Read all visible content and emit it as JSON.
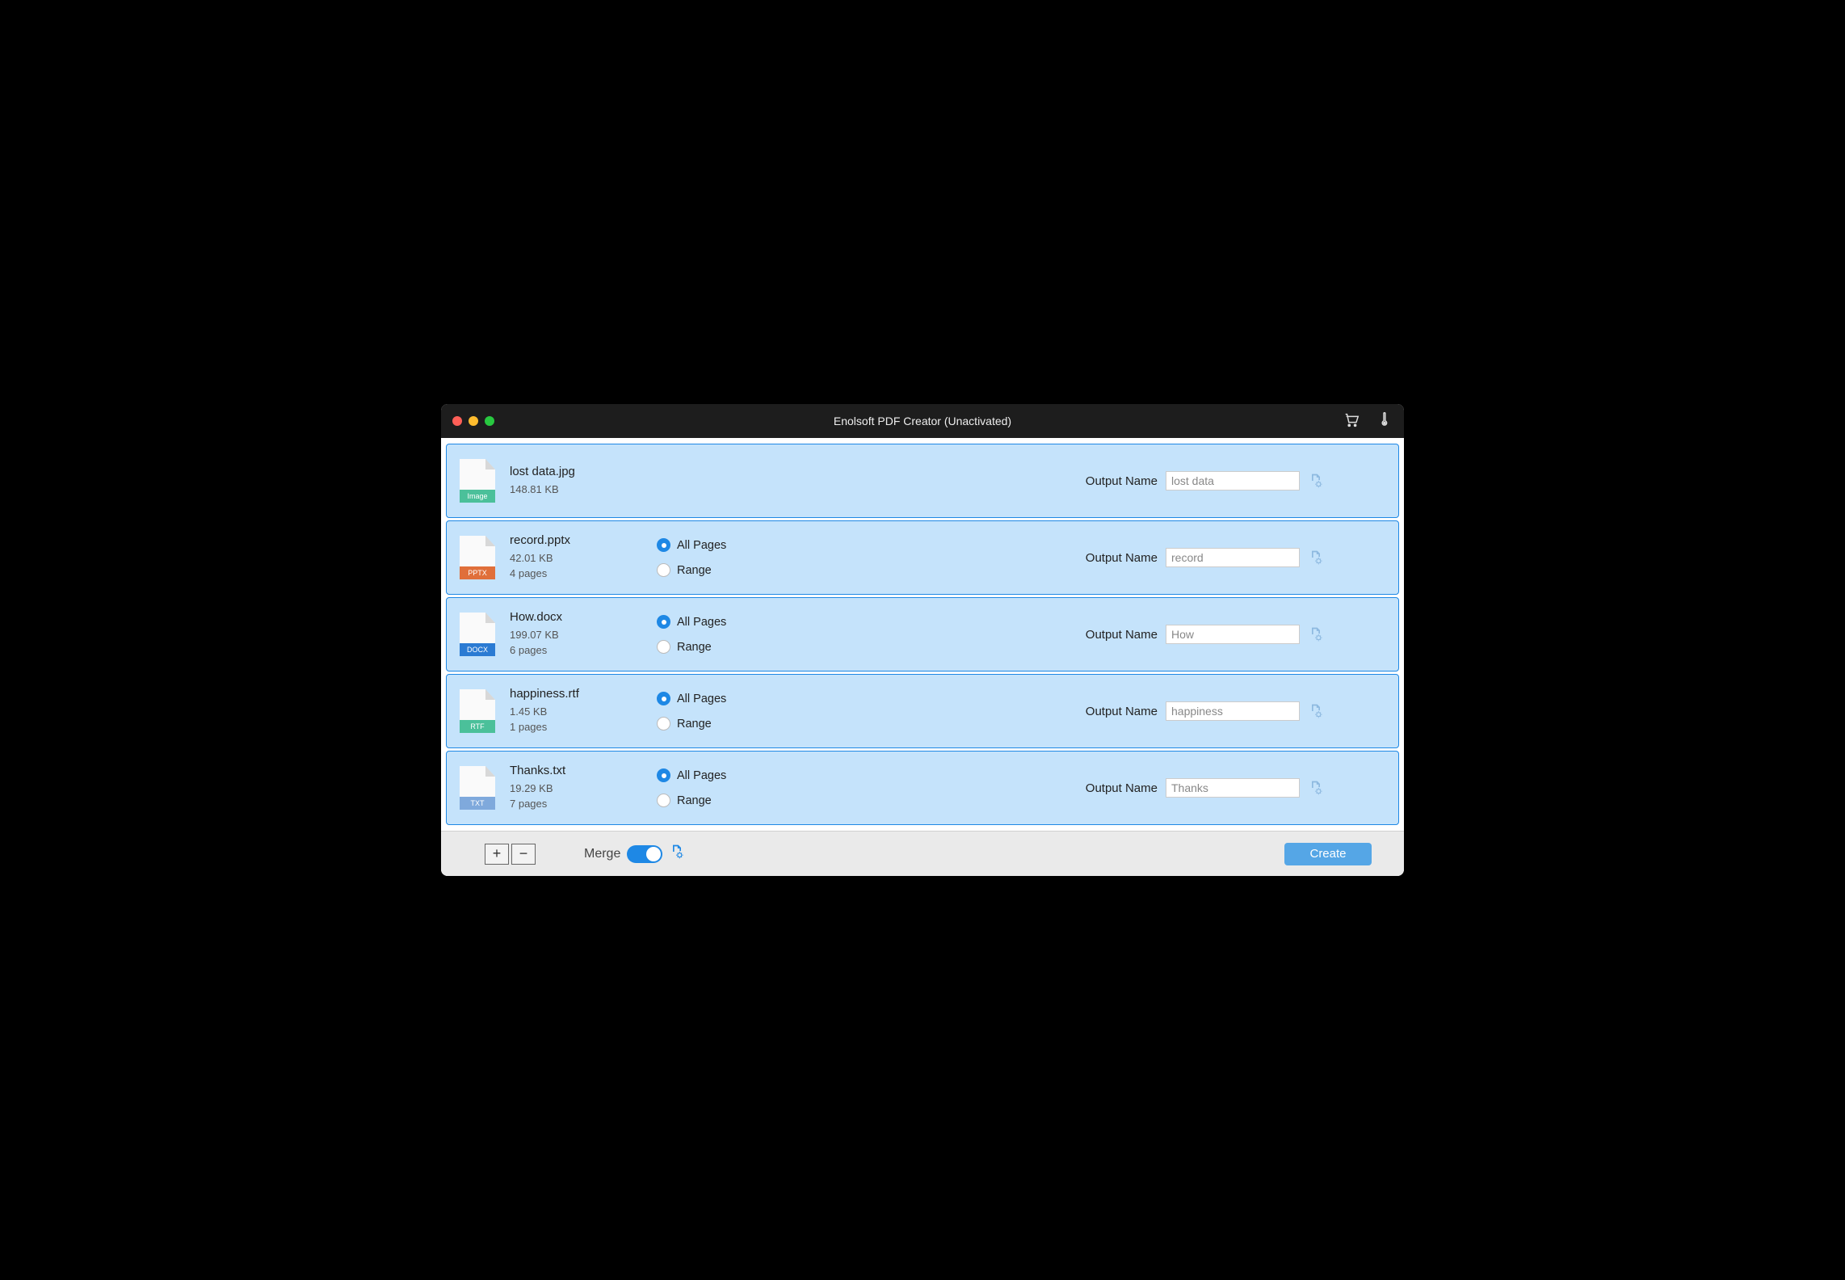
{
  "window": {
    "title": "Enolsoft PDF Creator (Unactivated)"
  },
  "labels": {
    "output_name": "Output Name",
    "all_pages": "All Pages",
    "range": "Range",
    "merge": "Merge",
    "create": "Create"
  },
  "files": [
    {
      "name": "lost data.jpg",
      "size": "148.81 KB",
      "pages": "",
      "type": "Image",
      "type_color": "#4bc09a",
      "output_placeholder": "lost data",
      "has_page_options": false
    },
    {
      "name": "record.pptx",
      "size": "42.01 KB",
      "pages": "4 pages",
      "type": "PPTX",
      "type_color": "#e06f3a",
      "output_placeholder": "record",
      "has_page_options": true
    },
    {
      "name": "How.docx",
      "size": "199.07 KB",
      "pages": "6 pages",
      "type": "DOCX",
      "type_color": "#2b7bd3",
      "output_placeholder": "How",
      "has_page_options": true
    },
    {
      "name": "happiness.rtf",
      "size": "1.45 KB",
      "pages": "1 pages",
      "type": "RTF",
      "type_color": "#4bc09a",
      "output_placeholder": "happiness",
      "has_page_options": true
    },
    {
      "name": "Thanks.txt",
      "size": "19.29 KB",
      "pages": "7 pages",
      "type": "TXT",
      "type_color": "#7fa9dc",
      "output_placeholder": "Thanks",
      "has_page_options": true
    }
  ]
}
